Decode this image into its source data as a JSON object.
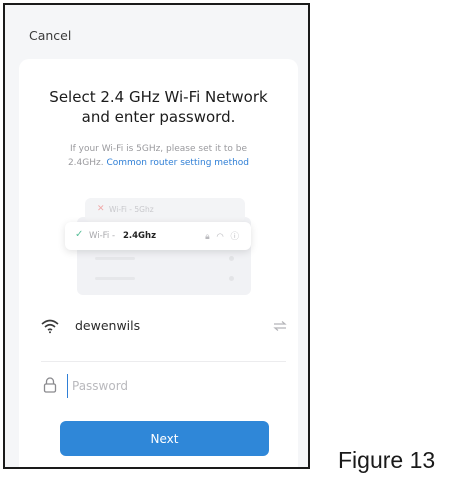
{
  "header": {
    "cancel_label": "Cancel"
  },
  "title": {
    "line1": "Select 2.4 GHz Wi-Fi Network",
    "line2": "and enter password."
  },
  "hint": {
    "text_line1": "If your Wi-Fi is 5GHz, please set it to be",
    "text_prefix": "2.4GHz.",
    "link_label": "Common router setting method"
  },
  "illustration": {
    "row_5g": {
      "prefix": "Wi-Fi -",
      "band": "5Ghz",
      "status": "invalid"
    },
    "row_24": {
      "prefix": "Wi-Fi -",
      "band": "2.4Ghz",
      "status": "valid"
    }
  },
  "network": {
    "ssid": "dewenwils",
    "icon": "wifi-icon",
    "switch_icon": "switch-arrows-icon"
  },
  "password": {
    "placeholder": "Password",
    "icon": "lock-icon"
  },
  "actions": {
    "next_label": "Next"
  },
  "figure_caption": "Figure 13",
  "colors": {
    "accent": "#2f87d8",
    "link": "#2f7fd6",
    "check": "#5bbf9a",
    "cross": "#f0a9a9"
  }
}
